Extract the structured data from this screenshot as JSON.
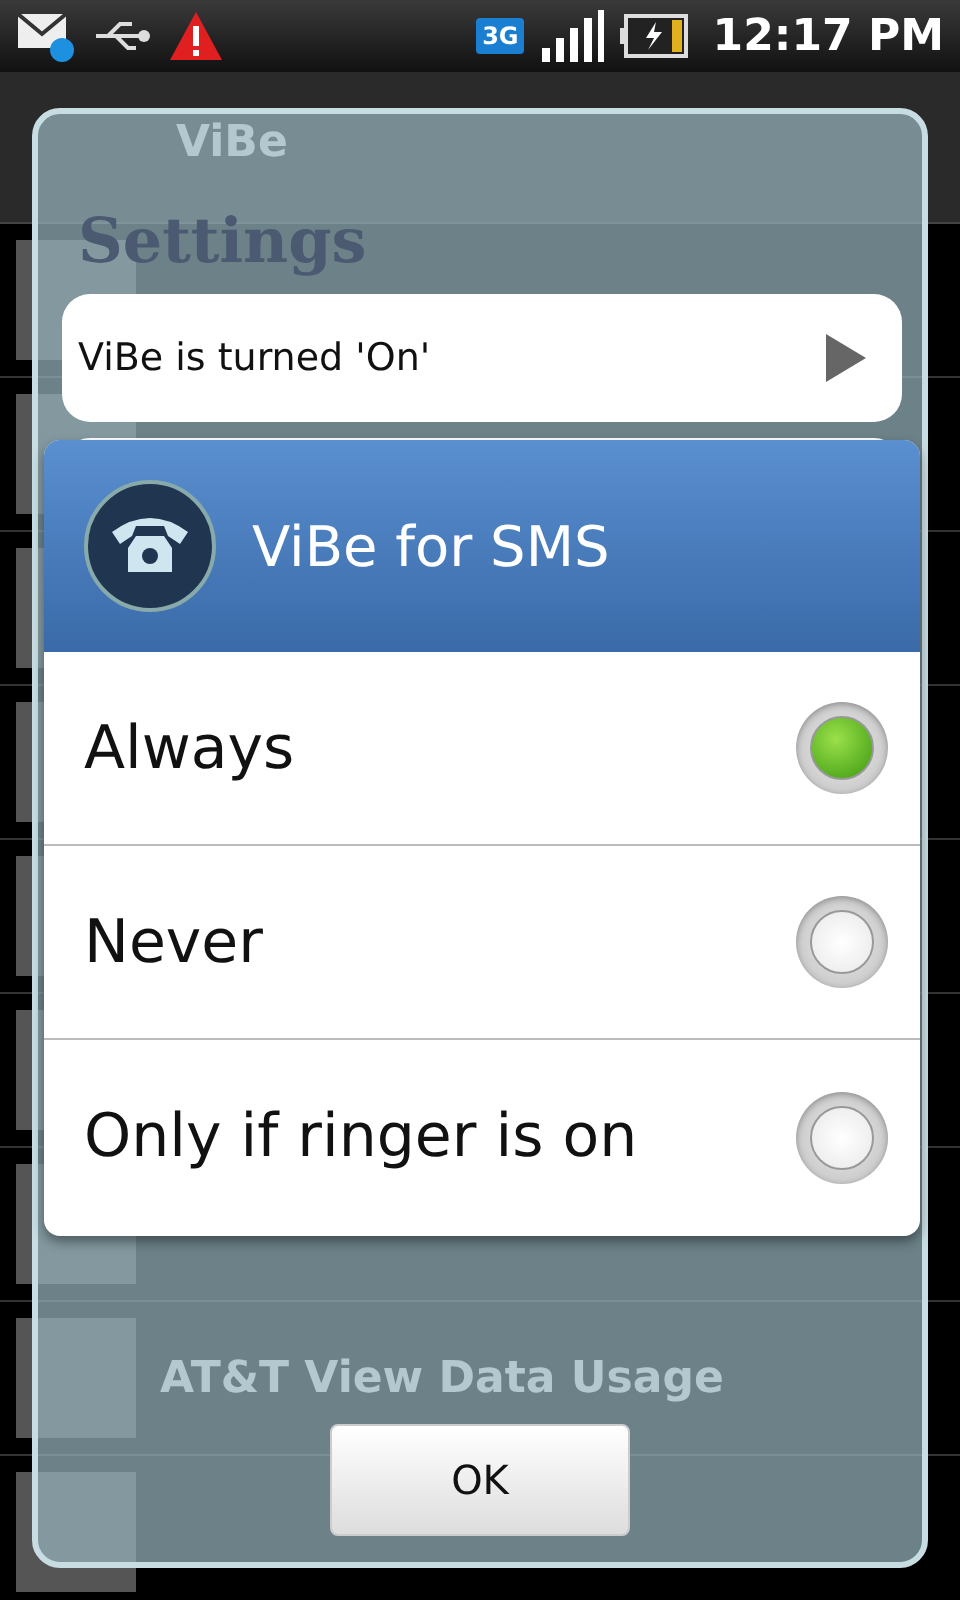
{
  "status_bar": {
    "network": "3G",
    "time": "12:17 PM"
  },
  "app_header": {
    "title": "ViBe"
  },
  "background_item": {
    "label": "AT&T View Data Usage"
  },
  "settings": {
    "title": "Settings",
    "rows": [
      {
        "label": "ViBe is turned 'On'"
      }
    ]
  },
  "dialog": {
    "title": "ViBe for SMS",
    "options": [
      {
        "label": "Always",
        "selected": true
      },
      {
        "label": "Never",
        "selected": false
      },
      {
        "label": "Only if ringer is on",
        "selected": false
      }
    ]
  },
  "ok_button": "OK"
}
